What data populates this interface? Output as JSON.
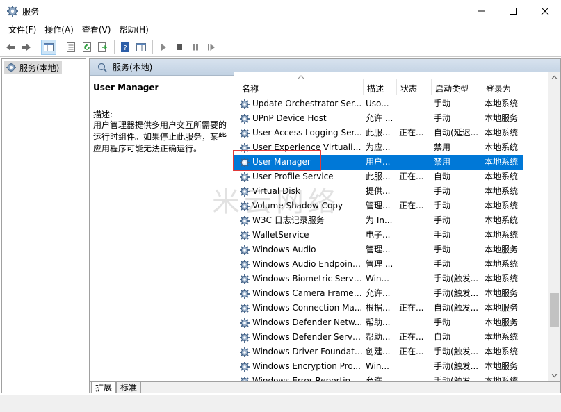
{
  "window": {
    "title": "服务",
    "icon": "services-gear-icon",
    "controls": [
      "minimize-icon",
      "maximize-icon",
      "close-icon"
    ]
  },
  "menu": {
    "items": [
      "文件(F)",
      "操作(A)",
      "查看(V)",
      "帮助(H)"
    ]
  },
  "toolbar": {
    "buttons": [
      "back-arrow-icon",
      "forward-arrow-icon",
      "console-tree-icon",
      "properties-icon",
      "refresh-icon",
      "export-list-icon",
      "help-icon",
      "show-hide-icon",
      "start-service-icon",
      "stop-service-icon",
      "pause-service-icon",
      "restart-service-icon"
    ]
  },
  "tree": {
    "selected_label": "服务(本地)"
  },
  "right_header": {
    "label": "服务(本地)"
  },
  "details": {
    "service_name": "User Manager",
    "description_label": "描述:",
    "description_text": "用户管理器提供多用户交互所需要的运行时组件。如果停止此服务，某些应用程序可能无法正确运行。"
  },
  "columns": {
    "name": "名称",
    "description": "描述",
    "status": "状态",
    "startup_type": "启动类型",
    "log_on_as": "登录为"
  },
  "services": [
    {
      "name": "Update Orchestrator Ser...",
      "desc": "Uso...",
      "status": "",
      "start": "手动",
      "logon": "本地系统"
    },
    {
      "name": "UPnP Device Host",
      "desc": "允许 ...",
      "status": "",
      "start": "手动",
      "logon": "本地服务"
    },
    {
      "name": "User Access Logging Ser...",
      "desc": "此服...",
      "status": "正在...",
      "start": "自动(延迟...",
      "logon": "本地系统"
    },
    {
      "name": "User Experience Virtualiz...",
      "desc": "为应...",
      "status": "",
      "start": "禁用",
      "logon": "本地系统"
    },
    {
      "name": "User Manager",
      "desc": "用户...",
      "status": "",
      "start": "禁用",
      "logon": "本地系统",
      "selected": true
    },
    {
      "name": "User Profile Service",
      "desc": "此服...",
      "status": "正在...",
      "start": "自动",
      "logon": "本地系统"
    },
    {
      "name": "Virtual Disk",
      "desc": "提供...",
      "status": "",
      "start": "手动",
      "logon": "本地系统"
    },
    {
      "name": "Volume Shadow Copy",
      "desc": "管理...",
      "status": "正在...",
      "start": "手动",
      "logon": "本地系统"
    },
    {
      "name": "W3C 日志记录服务",
      "desc": "为 In...",
      "status": "",
      "start": "手动",
      "logon": "本地系统"
    },
    {
      "name": "WalletService",
      "desc": "电子...",
      "status": "",
      "start": "手动",
      "logon": "本地系统"
    },
    {
      "name": "Windows Audio",
      "desc": "管理...",
      "status": "",
      "start": "手动",
      "logon": "本地服务"
    },
    {
      "name": "Windows Audio Endpoint...",
      "desc": "管理 ...",
      "status": "",
      "start": "手动",
      "logon": "本地系统"
    },
    {
      "name": "Windows Biometric Servi...",
      "desc": "Win...",
      "status": "",
      "start": "手动(触发...",
      "logon": "本地系统"
    },
    {
      "name": "Windows Camera Frame ...",
      "desc": "允许...",
      "status": "",
      "start": "手动(触发...",
      "logon": "本地服务"
    },
    {
      "name": "Windows Connection Ma...",
      "desc": "根据...",
      "status": "正在...",
      "start": "自动(触发...",
      "logon": "本地服务"
    },
    {
      "name": "Windows Defender Netw...",
      "desc": "帮助...",
      "status": "",
      "start": "手动",
      "logon": "本地服务"
    },
    {
      "name": "Windows Defender Service",
      "desc": "帮助...",
      "status": "正在...",
      "start": "自动",
      "logon": "本地系统"
    },
    {
      "name": "Windows Driver Foundati...",
      "desc": "创建...",
      "status": "正在...",
      "start": "手动(触发...",
      "logon": "本地系统"
    },
    {
      "name": "Windows Encryption Pro...",
      "desc": "Win...",
      "status": "",
      "start": "手动(触发...",
      "logon": "本地服务"
    },
    {
      "name": "Windows Error Reportin...",
      "desc": "允许...",
      "status": "",
      "start": "手动(触发...",
      "logon": "本地系统"
    }
  ],
  "tabs": [
    "扩展",
    "标准"
  ],
  "watermark": "米云网络",
  "colors": {
    "selection": "#0078d7",
    "highlight_box": "#e03a3a",
    "header_gradient": "#c2d2e3"
  }
}
